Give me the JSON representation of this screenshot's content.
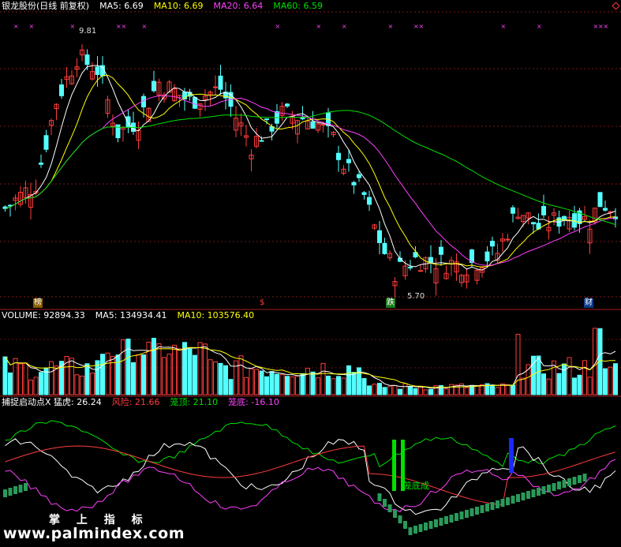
{
  "header": {
    "stock_name": "银龙股份(日线 前复权)",
    "ma5": "MA5: 6.69",
    "ma10": "MA10: 6.69",
    "ma20": "MA20: 6.64",
    "ma60": "MA60: 6.59"
  },
  "volume_header": {
    "volume": "VOLUME: 92894.33",
    "ma5": "MA5: 134934.41",
    "ma10": "MA10: 103576.40"
  },
  "indicator_header": {
    "name": "捕捉启动点X",
    "meng_hu": "猛虎: 26.24",
    "feng_xian": "风险: 21.66",
    "long_ding": "笼顶: 21.10",
    "long_di": "笼底: -16.10"
  },
  "annotations": {
    "high_label": "9.81",
    "low_label": "5.70",
    "badge_1": "榜",
    "badge_2": "$",
    "badge_3": "跌",
    "badge_4": "财",
    "indicator_text": "笼底成"
  },
  "watermark": {
    "cn": "掌 上 指 标",
    "url": "www.palmindex.com"
  },
  "colors": {
    "up": "#ff3c3c",
    "down": "#54ffff",
    "ma5": "#ffffff",
    "ma10": "#ffff00",
    "ma20": "#ff40ff",
    "ma60": "#00e000"
  },
  "chart_data": [
    {
      "type": "candlestick",
      "title": "银龙股份(日线 前复权)",
      "n_bars": 120,
      "price_range": [
        5.5,
        10.0
      ],
      "ma_lines": {
        "MA5": 6.69,
        "MA10": 6.69,
        "MA20": 6.64,
        "MA60": 6.59
      },
      "highest": 9.81,
      "lowest": 5.7
    },
    {
      "type": "bar",
      "title": "VOLUME",
      "last_volume": 92894.33,
      "ma5": 134934.41,
      "ma10": 103576.4
    },
    {
      "type": "line",
      "title": "捕捉启动点X",
      "series": [
        {
          "name": "猛虎",
          "last": 26.24
        },
        {
          "name": "风险",
          "last": 21.66
        },
        {
          "name": "笼顶",
          "last": 21.1
        },
        {
          "name": "笼底",
          "last": -16.1
        }
      ]
    }
  ]
}
